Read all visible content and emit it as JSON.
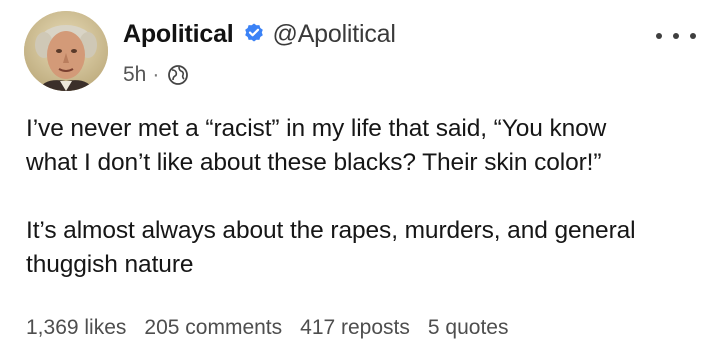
{
  "author": {
    "display_name": "Apolitical",
    "handle": "@Apolitical",
    "verified": true,
    "avatar_icon": "portrait-avatar"
  },
  "post": {
    "timestamp": "5h",
    "separator": "·",
    "visibility_icon": "globe-icon",
    "lines": [
      "I’ve never met a “racist” in my life that said, “You know",
      "what I don’t like about these blacks? Their skin color!”",
      "It’s almost always about the rapes, murders, and general",
      "thuggish nature"
    ]
  },
  "stats": {
    "likes": "1,369 likes",
    "comments": "205 comments",
    "reposts": "417 reposts",
    "quotes": "5 quotes"
  },
  "colors": {
    "verified_badge": "#3b82f6",
    "text": "#161616",
    "muted": "#555555"
  }
}
